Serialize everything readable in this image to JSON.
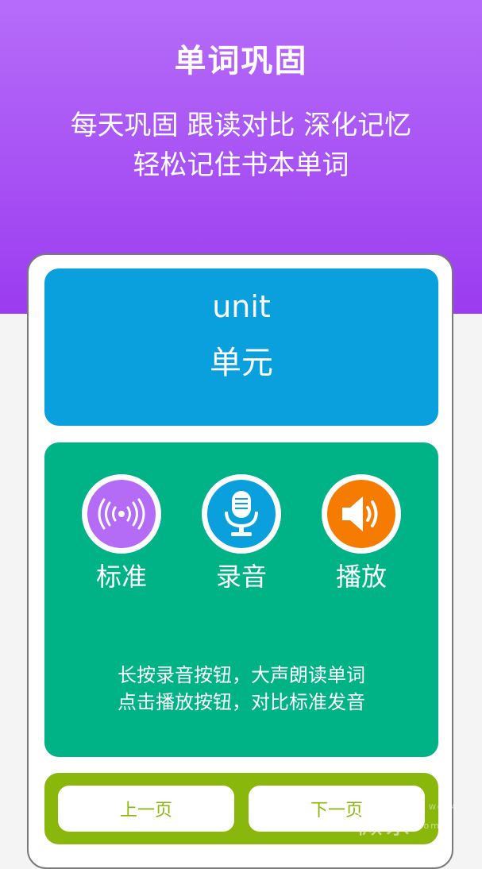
{
  "hero": {
    "title": "单词巩固",
    "subtitle_line1": "每天巩固 跟读对比 深化记忆",
    "subtitle_line2": "轻松记住书本单词"
  },
  "word": {
    "english": "unit",
    "chinese": "单元"
  },
  "controls": [
    {
      "label": "标准",
      "icon": "broadcast-icon",
      "color": "#b46cf7"
    },
    {
      "label": "录音",
      "icon": "microphone-icon",
      "color": "#0aa0de"
    },
    {
      "label": "播放",
      "icon": "speaker-icon",
      "color": "#f57c00"
    }
  ],
  "hint": {
    "line1": "长按录音按钮，大声朗读单词",
    "line2": "点击播放按钮，对比标准发音"
  },
  "nav": {
    "prev_label": "上一页",
    "next_label": "下一页"
  },
  "watermark": {
    "text": "微茶",
    "suffix": ".com",
    "tag": "WCHA"
  },
  "colors": {
    "hero": "#a24ef2",
    "word_panel": "#0aa0de",
    "practice_panel": "#00b386",
    "nav_panel": "#8ab70b"
  }
}
